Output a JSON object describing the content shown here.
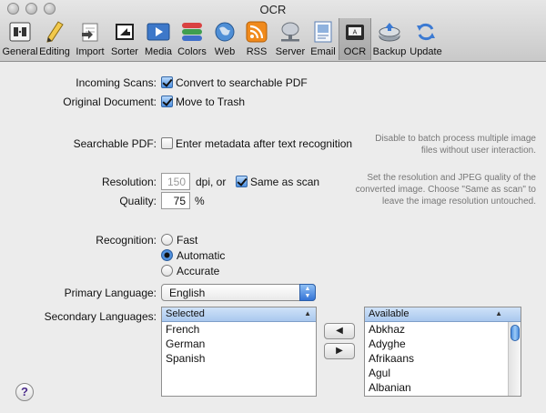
{
  "window": {
    "title": "OCR"
  },
  "toolbar": {
    "tabs": [
      {
        "label": "General",
        "icon": "general-icon"
      },
      {
        "label": "Editing",
        "icon": "pencil-icon"
      },
      {
        "label": "Import",
        "icon": "import-icon"
      },
      {
        "label": "Sorter",
        "icon": "sorter-icon"
      },
      {
        "label": "Media",
        "icon": "media-icon"
      },
      {
        "label": "Colors",
        "icon": "colors-icon"
      },
      {
        "label": "Web",
        "icon": "globe-icon"
      },
      {
        "label": "RSS",
        "icon": "rss-icon"
      },
      {
        "label": "Server",
        "icon": "server-icon"
      },
      {
        "label": "Email",
        "icon": "email-icon"
      },
      {
        "label": "OCR",
        "icon": "scanner-icon",
        "selected": true
      },
      {
        "label": "Backup",
        "icon": "backup-icon"
      },
      {
        "label": "Update",
        "icon": "update-icon"
      }
    ]
  },
  "form": {
    "incoming_scans_label": "Incoming Scans:",
    "convert_label": "Convert to searchable PDF",
    "convert_checked": true,
    "original_document_label": "Original Document:",
    "move_trash_label": "Move to Trash",
    "move_trash_checked": true,
    "searchable_pdf_label": "Searchable PDF:",
    "metadata_label": "Enter metadata after text recognition",
    "metadata_checked": false,
    "batch_hint": "Disable to batch process multiple image files without user interaction.",
    "resolution_label": "Resolution:",
    "resolution_value": "150",
    "resolution_unit": "dpi, or",
    "same_as_scan_label": "Same as scan",
    "same_as_scan_checked": true,
    "quality_label": "Quality:",
    "quality_value": "75",
    "quality_unit": "%",
    "resolution_hint": "Set the resolution and JPEG quality of the converted image. Choose \"Same as scan\" to leave the image resolution untouched.",
    "recognition_label": "Recognition:",
    "recognition_options": [
      "Fast",
      "Automatic",
      "Accurate"
    ],
    "recognition_selected": "Automatic",
    "primary_language_label": "Primary Language:",
    "primary_language_value": "English",
    "secondary_languages_label": "Secondary Languages:",
    "selected_header": "Selected",
    "selected_items": [
      "French",
      "German",
      "Spanish"
    ],
    "available_header": "Available",
    "available_items": [
      "Abkhaz",
      "Adyghe",
      "Afrikaans",
      "Agul",
      "Albanian"
    ],
    "move_left": "◀",
    "move_right": "▶",
    "help": "?"
  }
}
